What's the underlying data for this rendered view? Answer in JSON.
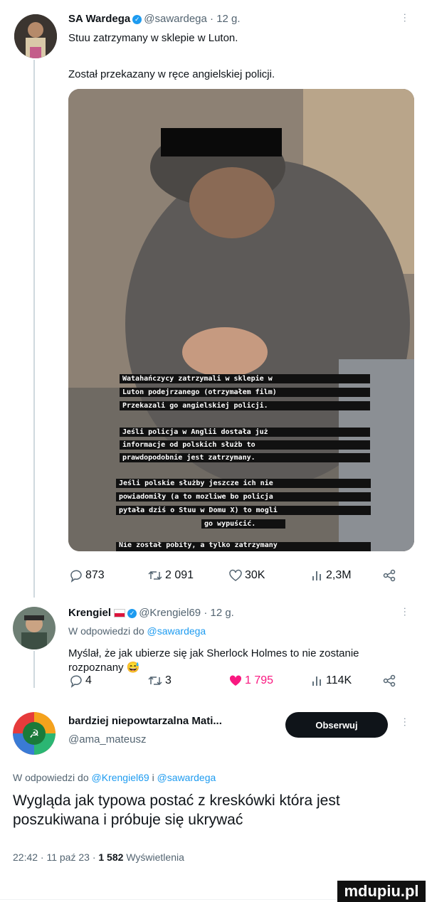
{
  "tweet1": {
    "author_name": "SA Wardega",
    "handle": "@sawardega",
    "time": "· 12 g.",
    "line1": "Stuu zatrzymany w sklepie w Luton.",
    "line2": "Został przekazany w ręce angielskiej policji.",
    "overlay": [
      "Watahańczycy zatrzymali w sklepie w",
      "Luton podejrzanego (otrzymałem film)",
      "Przekazali go angielskiej policji.",
      "Jeśli policja w Anglii dostała już",
      "informacje od polskich służb to",
      "prawdopodobnie jest zatrzymany.",
      "Jeśli polskie służby jeszcze ich nie",
      "powiadomiły (a to mozliwe bo policja",
      "pytała dziś o Stuu w Domu X) to mogli",
      "go wypuścić.",
      "Nie został pobity, a tylko zatrzymany"
    ],
    "actions": {
      "replies": "873",
      "retweets": "2 091",
      "likes": "30K",
      "views": "2,3M"
    }
  },
  "tweet2": {
    "author_name": "Krengiel",
    "handle": "@Krengiel69",
    "time": "· 12 g.",
    "reply_prefix": "W odpowiedzi do",
    "reply_to": "@sawardega",
    "text": "Myślał, że jak ubierze się jak Sherlock Holmes to nie zostanie rozpoznany 😅",
    "actions": {
      "replies": "4",
      "retweets": "3",
      "likes": "1 795",
      "views": "114K"
    },
    "colors": {
      "like_active": "#f91880"
    }
  },
  "tweet3": {
    "author_name": "bardziej niepowtarzalna Mati...",
    "handle": "@ama_mateusz",
    "follow_label": "Obserwuj",
    "reply_prefix": "W odpowiedzi do",
    "reply_to_1": "@Krengiel69",
    "reply_sep": "i",
    "reply_to_2": "@sawardega",
    "text": "Wygląda jak typowa postać z kreskówki która jest poszukiwana i próbuje się ukrywać",
    "meta_time": "22:42 · 11 paź 23 ·",
    "meta_views": "1 582",
    "meta_views_label": "Wyświetlenia"
  },
  "watermark": "mdupiu.pl"
}
